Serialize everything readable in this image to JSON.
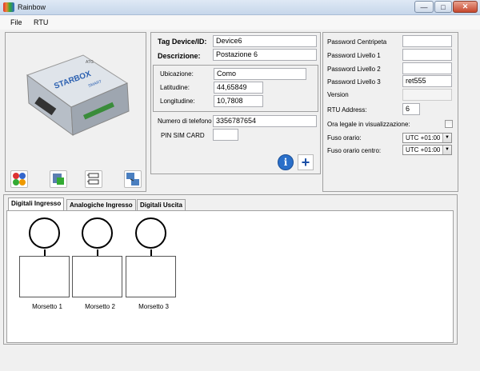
{
  "window": {
    "title": "Rainbow",
    "minimize": "—",
    "maximize": "□",
    "close": "✕"
  },
  "menu": {
    "items": [
      "File",
      "RTU"
    ]
  },
  "device_image": {
    "brand": "STARBOX",
    "sub": "SMART",
    "logo": "ATG"
  },
  "toolbar": {
    "icons": [
      "settings-colors-icon",
      "database-edit-icon",
      "io-modules-icon",
      "network-computers-icon"
    ]
  },
  "device_panel": {
    "tag_label": "Tag Device/ID:",
    "tag_value": "Device6",
    "desc_label": "Descrizione:",
    "desc_value": "Postazione 6",
    "ubicazione_label": "Ubicazione:",
    "ubicazione_value": "Como",
    "lat_label": "Latitudine:",
    "lat_value": "44,65849",
    "lon_label": "Longitudine:",
    "lon_value": "10,7808",
    "phone_label": "Numero di telefono",
    "phone_value": "3356787654",
    "pin_label": "PIN SIM CARD",
    "pin_value": "",
    "info_icon": "i",
    "add_icon": "+"
  },
  "password_panel": {
    "pw_centripeta_label": "Password Centripeta",
    "pw_centripeta_value": "",
    "pw_l1_label": "Password Livello 1",
    "pw_l1_value": "",
    "pw_l2_label": "Password Livello 2",
    "pw_l2_value": "",
    "pw_l3_label": "Password Livello 3",
    "pw_l3_value": "ret555",
    "version_label": "Version",
    "version_value": "",
    "rtu_label": "RTU Address:",
    "rtu_value": "6",
    "ora_legale_label": "Ora legale in visualizzazione:",
    "ora_legale_checked": false,
    "fuso_label": "Fuso orario:",
    "fuso_value": "UTC +01:00",
    "fuso_centro_label": "Fuso orario centro:",
    "fuso_centro_value": "UTC +01:00"
  },
  "tabs": [
    {
      "label": "Digitali Ingresso",
      "active": true
    },
    {
      "label": "Analogiche Ingresso",
      "active": false
    },
    {
      "label": "Digitali Uscita",
      "active": false
    }
  ],
  "terminals": [
    "Morsetto 1",
    "Morsetto 2",
    "Morsetto 3"
  ]
}
